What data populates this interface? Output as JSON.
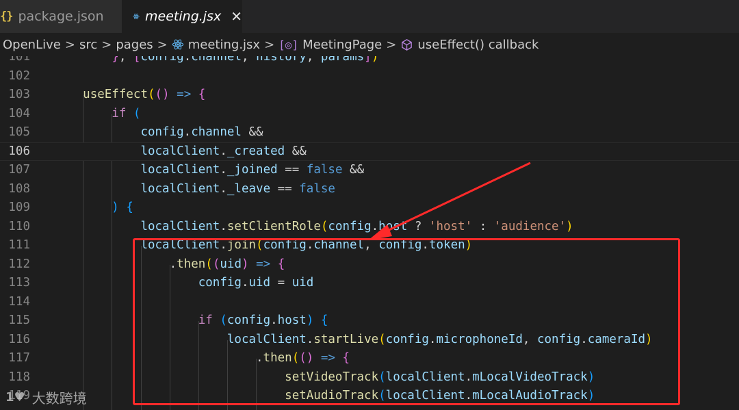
{
  "tabs": [
    {
      "label": "package.json",
      "icon": "json-braces-icon",
      "active": false
    },
    {
      "label": "meeting.jsx",
      "icon": "react-icon",
      "active": true
    }
  ],
  "breadcrumb": [
    {
      "label": "OpenLive"
    },
    {
      "label": "src"
    },
    {
      "label": "pages"
    },
    {
      "label": "meeting.jsx",
      "icon": "react-icon"
    },
    {
      "label": "MeetingPage",
      "icon": "method-icon"
    },
    {
      "label": "useEffect() callback",
      "icon": "cube-icon"
    }
  ],
  "editor": {
    "current_line": "106",
    "lines": [
      {
        "n": "101",
        "tokens": [
          [
            "plain",
            "        "
          ],
          [
            "br2",
            "}"
          ],
          [
            "plain",
            ", "
          ],
          [
            "br2",
            "["
          ],
          [
            "var",
            "config"
          ],
          [
            "plain",
            "."
          ],
          [
            "var",
            "channel"
          ],
          [
            "plain",
            ", "
          ],
          [
            "var",
            "history"
          ],
          [
            "plain",
            ", "
          ],
          [
            "var",
            "params"
          ],
          [
            "br2",
            "]"
          ],
          [
            "br1",
            ")"
          ]
        ]
      },
      {
        "n": "102",
        "tokens": []
      },
      {
        "n": "103",
        "tokens": [
          [
            "plain",
            "    "
          ],
          [
            "fn",
            "useEffect"
          ],
          [
            "br1",
            "("
          ],
          [
            "br2",
            "("
          ],
          [
            "br2",
            ")"
          ],
          [
            "plain",
            " "
          ],
          [
            "kw",
            "=>"
          ],
          [
            "plain",
            " "
          ],
          [
            "br2",
            "{"
          ]
        ]
      },
      {
        "n": "104",
        "tokens": [
          [
            "plain",
            "        "
          ],
          [
            "ctl",
            "if"
          ],
          [
            "plain",
            " "
          ],
          [
            "br3",
            "("
          ]
        ]
      },
      {
        "n": "105",
        "tokens": [
          [
            "plain",
            "            "
          ],
          [
            "var",
            "config"
          ],
          [
            "plain",
            "."
          ],
          [
            "var",
            "channel"
          ],
          [
            "plain",
            " &&"
          ]
        ]
      },
      {
        "n": "106",
        "tokens": [
          [
            "plain",
            "            "
          ],
          [
            "var",
            "localClient"
          ],
          [
            "plain",
            "."
          ],
          [
            "var",
            "_created"
          ],
          [
            "plain",
            " &&"
          ]
        ]
      },
      {
        "n": "107",
        "tokens": [
          [
            "plain",
            "            "
          ],
          [
            "var",
            "localClient"
          ],
          [
            "plain",
            "."
          ],
          [
            "var",
            "_joined"
          ],
          [
            "plain",
            " == "
          ],
          [
            "kw",
            "false"
          ],
          [
            "plain",
            " &&"
          ]
        ]
      },
      {
        "n": "108",
        "tokens": [
          [
            "plain",
            "            "
          ],
          [
            "var",
            "localClient"
          ],
          [
            "plain",
            "."
          ],
          [
            "var",
            "_leave"
          ],
          [
            "plain",
            " == "
          ],
          [
            "kw",
            "false"
          ]
        ]
      },
      {
        "n": "109",
        "tokens": [
          [
            "plain",
            "        "
          ],
          [
            "br3",
            ")"
          ],
          [
            "plain",
            " "
          ],
          [
            "br3",
            "{"
          ]
        ]
      },
      {
        "n": "110",
        "tokens": [
          [
            "plain",
            "            "
          ],
          [
            "var",
            "localClient"
          ],
          [
            "plain",
            "."
          ],
          [
            "fn",
            "setClientRole"
          ],
          [
            "br1",
            "("
          ],
          [
            "var",
            "config"
          ],
          [
            "plain",
            "."
          ],
          [
            "var",
            "host"
          ],
          [
            "plain",
            " ? "
          ],
          [
            "str",
            "'host'"
          ],
          [
            "plain",
            " : "
          ],
          [
            "str",
            "'audience'"
          ],
          [
            "br1",
            ")"
          ]
        ]
      },
      {
        "n": "111",
        "tokens": [
          [
            "plain",
            "            "
          ],
          [
            "var",
            "localClient"
          ],
          [
            "plain",
            "."
          ],
          [
            "fn",
            "join"
          ],
          [
            "br1",
            "("
          ],
          [
            "var",
            "config"
          ],
          [
            "plain",
            "."
          ],
          [
            "var",
            "channel"
          ],
          [
            "plain",
            ", "
          ],
          [
            "var",
            "config"
          ],
          [
            "plain",
            "."
          ],
          [
            "var",
            "token"
          ],
          [
            "br1",
            ")"
          ]
        ]
      },
      {
        "n": "112",
        "tokens": [
          [
            "plain",
            "                ."
          ],
          [
            "fn",
            "then"
          ],
          [
            "br1",
            "("
          ],
          [
            "br2",
            "("
          ],
          [
            "var",
            "uid"
          ],
          [
            "br2",
            ")"
          ],
          [
            "plain",
            " "
          ],
          [
            "kw",
            "=>"
          ],
          [
            "plain",
            " "
          ],
          [
            "br2",
            "{"
          ]
        ]
      },
      {
        "n": "113",
        "tokens": [
          [
            "plain",
            "                    "
          ],
          [
            "var",
            "config"
          ],
          [
            "plain",
            "."
          ],
          [
            "var",
            "uid"
          ],
          [
            "plain",
            " = "
          ],
          [
            "var",
            "uid"
          ]
        ]
      },
      {
        "n": "114",
        "tokens": []
      },
      {
        "n": "115",
        "tokens": [
          [
            "plain",
            "                    "
          ],
          [
            "ctl",
            "if"
          ],
          [
            "plain",
            " "
          ],
          [
            "br3",
            "("
          ],
          [
            "var",
            "config"
          ],
          [
            "plain",
            "."
          ],
          [
            "var",
            "host"
          ],
          [
            "br3",
            ")"
          ],
          [
            "plain",
            " "
          ],
          [
            "br3",
            "{"
          ]
        ]
      },
      {
        "n": "116",
        "tokens": [
          [
            "plain",
            "                        "
          ],
          [
            "var",
            "localClient"
          ],
          [
            "plain",
            "."
          ],
          [
            "fn",
            "startLive"
          ],
          [
            "br1",
            "("
          ],
          [
            "var",
            "config"
          ],
          [
            "plain",
            "."
          ],
          [
            "var",
            "microphoneId"
          ],
          [
            "plain",
            ", "
          ],
          [
            "var",
            "config"
          ],
          [
            "plain",
            "."
          ],
          [
            "var",
            "cameraId"
          ],
          [
            "br1",
            ")"
          ]
        ]
      },
      {
        "n": "117",
        "tokens": [
          [
            "plain",
            "                            ."
          ],
          [
            "fn",
            "then"
          ],
          [
            "br1",
            "("
          ],
          [
            "br2",
            "("
          ],
          [
            "br2",
            ")"
          ],
          [
            "plain",
            " "
          ],
          [
            "kw",
            "=>"
          ],
          [
            "plain",
            " "
          ],
          [
            "br2",
            "{"
          ]
        ]
      },
      {
        "n": "118",
        "tokens": [
          [
            "plain",
            "                                "
          ],
          [
            "fn",
            "setVideoTrack"
          ],
          [
            "br3",
            "("
          ],
          [
            "var",
            "localClient"
          ],
          [
            "plain",
            "."
          ],
          [
            "var",
            "mLocalVideoTrack"
          ],
          [
            "br3",
            ")"
          ]
        ]
      },
      {
        "n": "119",
        "tokens": [
          [
            "plain",
            "                                "
          ],
          [
            "fn",
            "setAudioTrack"
          ],
          [
            "br3",
            "("
          ],
          [
            "var",
            "localClient"
          ],
          [
            "plain",
            "."
          ],
          [
            "var",
            "mLocalAudioTrack"
          ],
          [
            "br3",
            ")"
          ]
        ]
      }
    ]
  },
  "annotation": {
    "box_color": "#ff2a2a",
    "arrow_color": "#ff2a2a"
  },
  "watermark": {
    "logo": "1♥",
    "text": "大数跨境"
  }
}
